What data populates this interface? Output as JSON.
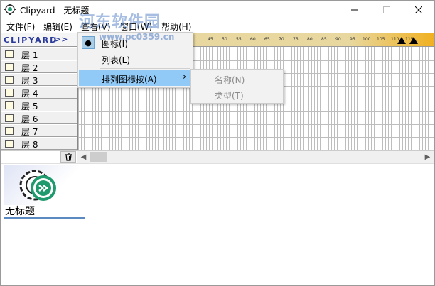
{
  "window": {
    "title": "Clipyard - 无标题"
  },
  "menubar": {
    "items": [
      "文件(F)",
      "编辑(E)",
      "查看(V)",
      "窗口(W)",
      "帮助(H)"
    ]
  },
  "brand": {
    "logo": "CLIPYARD",
    "arrows": ">>"
  },
  "ruler": {
    "numbers": [
      "45",
      "50",
      "55",
      "60",
      "65",
      "70",
      "75",
      "80",
      "85",
      "90",
      "95",
      "100",
      "105",
      "110",
      "115"
    ]
  },
  "layers": [
    {
      "label": "层 1"
    },
    {
      "label": "层 2"
    },
    {
      "label": "层 3"
    },
    {
      "label": "层 4"
    },
    {
      "label": "层 5"
    },
    {
      "label": "层 6"
    },
    {
      "label": "层 7"
    },
    {
      "label": "层 8"
    }
  ],
  "view_menu": {
    "icons_label": "图标(I)",
    "list_label": "列表(L)",
    "arrange_label": "排列图标按(A)",
    "arrange_arrow": "›"
  },
  "arrange_submenu": {
    "name_label": "名称(N)",
    "type_label": "类型(T)"
  },
  "document": {
    "title": "无标题"
  },
  "watermark": {
    "text": "河东软件园",
    "url": "www.pc0359.cn"
  },
  "colors": {
    "accent_green": "#1f9a6e",
    "ruler_orange": "#f0b020",
    "highlight": "#91c9f7"
  }
}
